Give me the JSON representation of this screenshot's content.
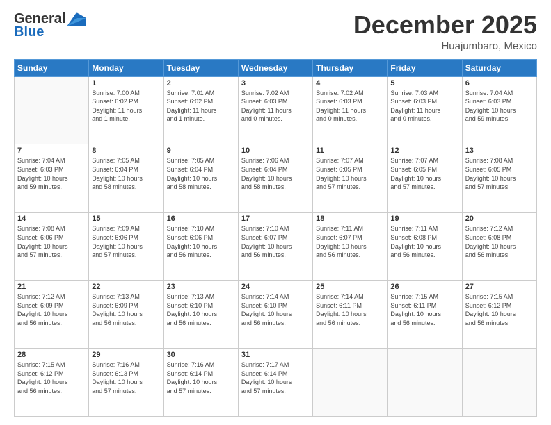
{
  "header": {
    "logo_general": "General",
    "logo_blue": "Blue",
    "month_title": "December 2025",
    "location": "Huajumbaro, Mexico"
  },
  "weekdays": [
    "Sunday",
    "Monday",
    "Tuesday",
    "Wednesday",
    "Thursday",
    "Friday",
    "Saturday"
  ],
  "weeks": [
    [
      {
        "day": "",
        "info": ""
      },
      {
        "day": "1",
        "info": "Sunrise: 7:00 AM\nSunset: 6:02 PM\nDaylight: 11 hours\nand 1 minute."
      },
      {
        "day": "2",
        "info": "Sunrise: 7:01 AM\nSunset: 6:02 PM\nDaylight: 11 hours\nand 1 minute."
      },
      {
        "day": "3",
        "info": "Sunrise: 7:02 AM\nSunset: 6:03 PM\nDaylight: 11 hours\nand 0 minutes."
      },
      {
        "day": "4",
        "info": "Sunrise: 7:02 AM\nSunset: 6:03 PM\nDaylight: 11 hours\nand 0 minutes."
      },
      {
        "day": "5",
        "info": "Sunrise: 7:03 AM\nSunset: 6:03 PM\nDaylight: 11 hours\nand 0 minutes."
      },
      {
        "day": "6",
        "info": "Sunrise: 7:04 AM\nSunset: 6:03 PM\nDaylight: 10 hours\nand 59 minutes."
      }
    ],
    [
      {
        "day": "7",
        "info": "Sunrise: 7:04 AM\nSunset: 6:03 PM\nDaylight: 10 hours\nand 59 minutes."
      },
      {
        "day": "8",
        "info": "Sunrise: 7:05 AM\nSunset: 6:04 PM\nDaylight: 10 hours\nand 58 minutes."
      },
      {
        "day": "9",
        "info": "Sunrise: 7:05 AM\nSunset: 6:04 PM\nDaylight: 10 hours\nand 58 minutes."
      },
      {
        "day": "10",
        "info": "Sunrise: 7:06 AM\nSunset: 6:04 PM\nDaylight: 10 hours\nand 58 minutes."
      },
      {
        "day": "11",
        "info": "Sunrise: 7:07 AM\nSunset: 6:05 PM\nDaylight: 10 hours\nand 57 minutes."
      },
      {
        "day": "12",
        "info": "Sunrise: 7:07 AM\nSunset: 6:05 PM\nDaylight: 10 hours\nand 57 minutes."
      },
      {
        "day": "13",
        "info": "Sunrise: 7:08 AM\nSunset: 6:05 PM\nDaylight: 10 hours\nand 57 minutes."
      }
    ],
    [
      {
        "day": "14",
        "info": "Sunrise: 7:08 AM\nSunset: 6:06 PM\nDaylight: 10 hours\nand 57 minutes."
      },
      {
        "day": "15",
        "info": "Sunrise: 7:09 AM\nSunset: 6:06 PM\nDaylight: 10 hours\nand 57 minutes."
      },
      {
        "day": "16",
        "info": "Sunrise: 7:10 AM\nSunset: 6:06 PM\nDaylight: 10 hours\nand 56 minutes."
      },
      {
        "day": "17",
        "info": "Sunrise: 7:10 AM\nSunset: 6:07 PM\nDaylight: 10 hours\nand 56 minutes."
      },
      {
        "day": "18",
        "info": "Sunrise: 7:11 AM\nSunset: 6:07 PM\nDaylight: 10 hours\nand 56 minutes."
      },
      {
        "day": "19",
        "info": "Sunrise: 7:11 AM\nSunset: 6:08 PM\nDaylight: 10 hours\nand 56 minutes."
      },
      {
        "day": "20",
        "info": "Sunrise: 7:12 AM\nSunset: 6:08 PM\nDaylight: 10 hours\nand 56 minutes."
      }
    ],
    [
      {
        "day": "21",
        "info": "Sunrise: 7:12 AM\nSunset: 6:09 PM\nDaylight: 10 hours\nand 56 minutes."
      },
      {
        "day": "22",
        "info": "Sunrise: 7:13 AM\nSunset: 6:09 PM\nDaylight: 10 hours\nand 56 minutes."
      },
      {
        "day": "23",
        "info": "Sunrise: 7:13 AM\nSunset: 6:10 PM\nDaylight: 10 hours\nand 56 minutes."
      },
      {
        "day": "24",
        "info": "Sunrise: 7:14 AM\nSunset: 6:10 PM\nDaylight: 10 hours\nand 56 minutes."
      },
      {
        "day": "25",
        "info": "Sunrise: 7:14 AM\nSunset: 6:11 PM\nDaylight: 10 hours\nand 56 minutes."
      },
      {
        "day": "26",
        "info": "Sunrise: 7:15 AM\nSunset: 6:11 PM\nDaylight: 10 hours\nand 56 minutes."
      },
      {
        "day": "27",
        "info": "Sunrise: 7:15 AM\nSunset: 6:12 PM\nDaylight: 10 hours\nand 56 minutes."
      }
    ],
    [
      {
        "day": "28",
        "info": "Sunrise: 7:15 AM\nSunset: 6:12 PM\nDaylight: 10 hours\nand 56 minutes."
      },
      {
        "day": "29",
        "info": "Sunrise: 7:16 AM\nSunset: 6:13 PM\nDaylight: 10 hours\nand 57 minutes."
      },
      {
        "day": "30",
        "info": "Sunrise: 7:16 AM\nSunset: 6:14 PM\nDaylight: 10 hours\nand 57 minutes."
      },
      {
        "day": "31",
        "info": "Sunrise: 7:17 AM\nSunset: 6:14 PM\nDaylight: 10 hours\nand 57 minutes."
      },
      {
        "day": "",
        "info": ""
      },
      {
        "day": "",
        "info": ""
      },
      {
        "day": "",
        "info": ""
      }
    ]
  ]
}
